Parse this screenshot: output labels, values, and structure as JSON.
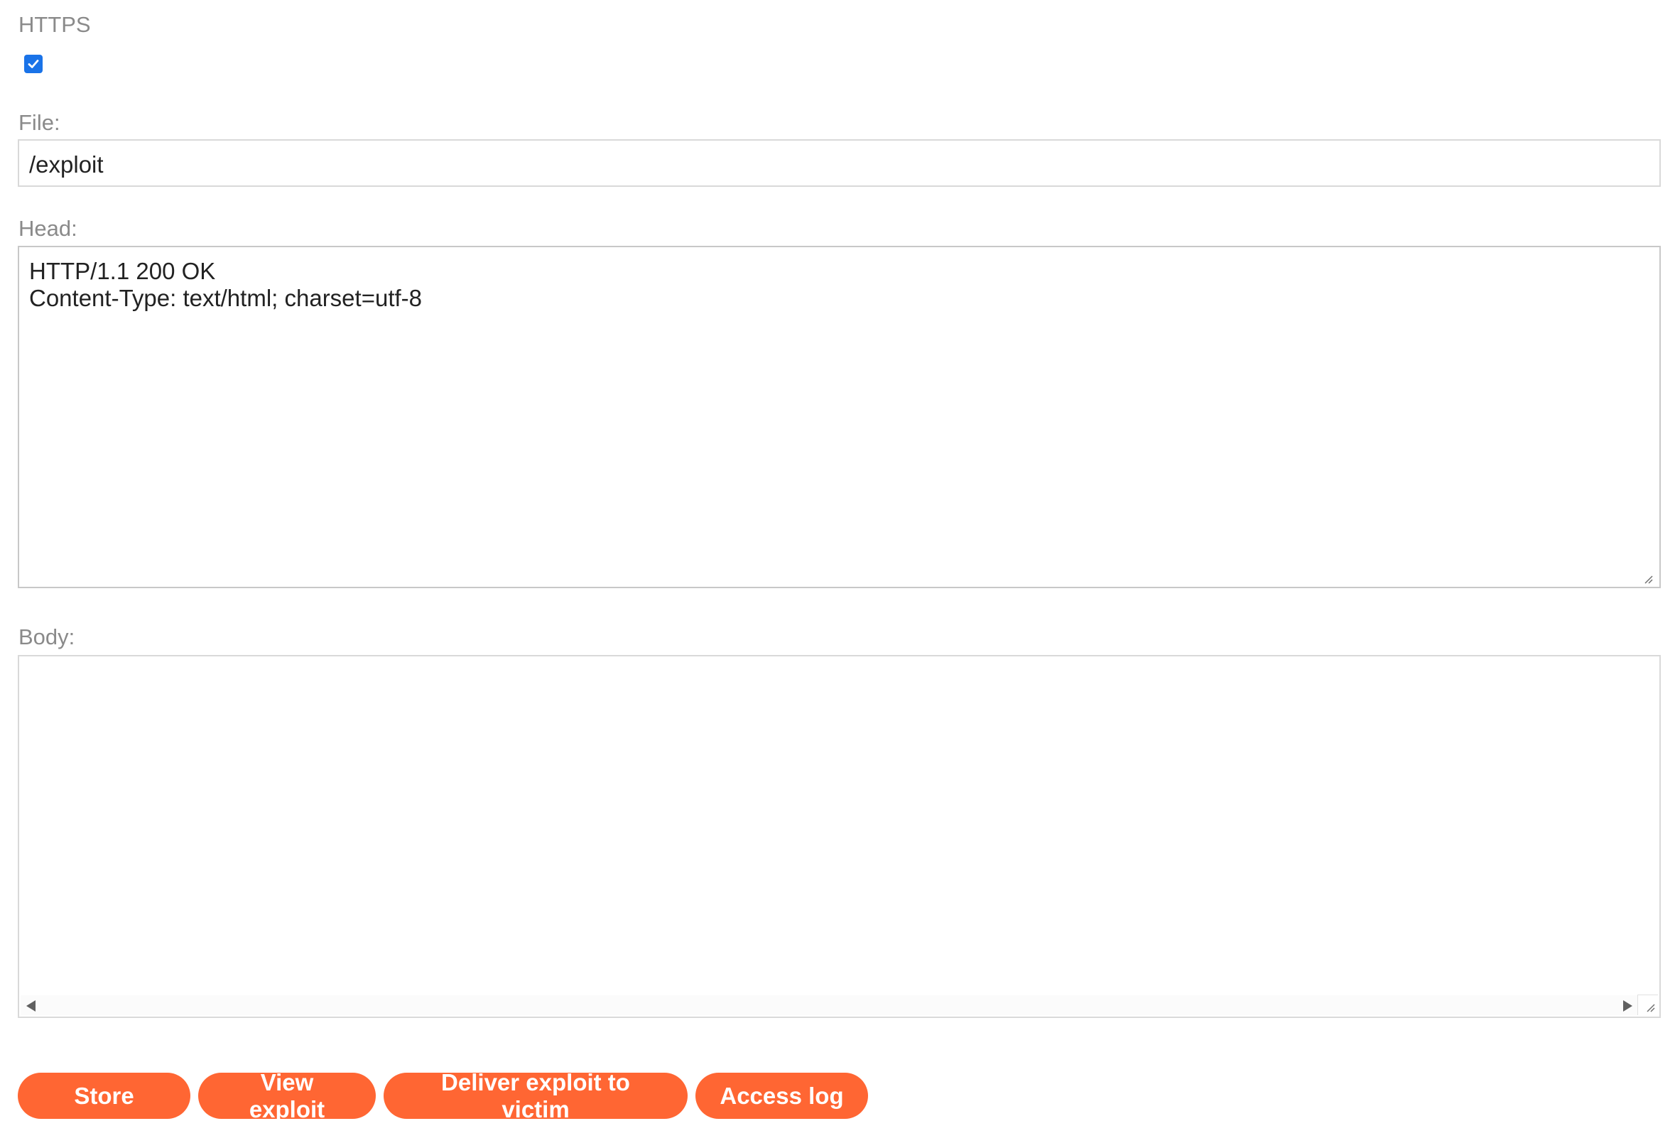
{
  "https": {
    "label": "HTTPS",
    "checked": true
  },
  "file": {
    "label": "File:",
    "value": "/exploit"
  },
  "head": {
    "label": "Head:",
    "value": "HTTP/1.1 200 OK\nContent-Type: text/html; charset=utf-8"
  },
  "body": {
    "label": "Body:",
    "value": ""
  },
  "buttons": {
    "store": "Store",
    "view_exploit": "View exploit",
    "deliver": "Deliver exploit to victim",
    "access_log": "Access log"
  },
  "colors": {
    "accent": "#ff6633",
    "checkbox": "#1a73e8",
    "label": "#8a8a8a"
  }
}
